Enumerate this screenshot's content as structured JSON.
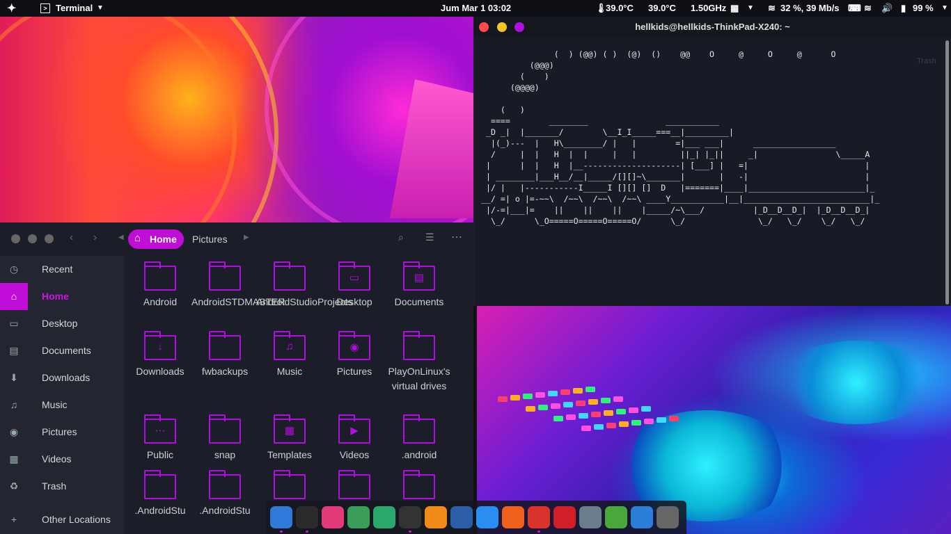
{
  "topbar": {
    "app_name": "Terminal",
    "clock": "Jum Mar 1  03:02",
    "temp1": "39.0°C",
    "temp2": "39.0°C",
    "cpu_freq": "1.50GHz",
    "net_speed": "32 %, 39 Mb/s",
    "battery": "99 %"
  },
  "terminal": {
    "title": "hellkids@hellkids-ThinkPad-X240: ~",
    "trash_label": "Trash",
    "ascii": "               (  ) (@@) ( )  (@)  ()    @@    O     @     O     @      O\n          (@@@)\n        (    )\n      (@@@@)\n\n    (   )\n  ====        ________                ___________\n _D _|  |_______/        \\__I_I_____===__|_________|\n  |(_)---  |   H\\________/ |   |        =|___ ___|      _________________\n  /     |  |   H  |  |     |   |         ||_| |_||     _|                \\_____A\n |      |  |   H  |__--------------------| [___] |   =|                        |\n | ________|___H__/__|_____/[][]~\\_______|       |   -|                        |\n |/ |   |-----------I_____I [][] []  D   |=======|____|________________________|_\n__/ =| o |=-~~\\  /~~\\  /~~\\  /~~\\ ____Y___________|__|__________________________|_\n |/-=|___|=    ||    ||    ||    |_____/~\\___/          |_D__D__D_|  |_D__D__D_|\n  \\_/      \\_O=====O=====O=====O/      \\_/               \\_/   \\_/    \\_/   \\_/"
  },
  "files": {
    "path": [
      {
        "label": "Home"
      },
      {
        "label": "Pictures"
      }
    ],
    "sidebar": [
      {
        "label": "Recent",
        "icon": "clock-icon",
        "glyph": "◷"
      },
      {
        "label": "Home",
        "icon": "home-icon",
        "glyph": "⌂"
      },
      {
        "label": "Desktop",
        "icon": "desktop-icon",
        "glyph": "▭"
      },
      {
        "label": "Documents",
        "icon": "documents-icon",
        "glyph": "▤"
      },
      {
        "label": "Downloads",
        "icon": "downloads-icon",
        "glyph": "⬇"
      },
      {
        "label": "Music",
        "icon": "music-icon",
        "glyph": "♫"
      },
      {
        "label": "Pictures",
        "icon": "camera-icon",
        "glyph": "◉"
      },
      {
        "label": "Videos",
        "icon": "film-icon",
        "glyph": "▦"
      },
      {
        "label": "Trash",
        "icon": "trash-icon",
        "glyph": "♻"
      },
      {
        "label": "Other Locations",
        "icon": "plus-icon",
        "glyph": "+"
      }
    ],
    "items": [
      {
        "name": "Android",
        "glyph": ""
      },
      {
        "name": "AndroidSTDMASTER",
        "glyph": ""
      },
      {
        "name": "AndroidStudioProjects",
        "glyph": ""
      },
      {
        "name": "Desktop",
        "glyph": "▭"
      },
      {
        "name": "Documents",
        "glyph": "▤"
      },
      {
        "name": "Downloads",
        "glyph": "↓"
      },
      {
        "name": "fwbackups",
        "glyph": ""
      },
      {
        "name": "Music",
        "glyph": "♫"
      },
      {
        "name": "Pictures",
        "glyph": "◉"
      },
      {
        "name": "PlayOnLinux's virtual drives",
        "glyph": ""
      },
      {
        "name": "Public",
        "glyph": "⋯"
      },
      {
        "name": "snap",
        "glyph": ""
      },
      {
        "name": "Templates",
        "glyph": "▦"
      },
      {
        "name": "Videos",
        "glyph": "▶"
      },
      {
        "name": ".android",
        "glyph": ""
      },
      {
        "name": ".AndroidStu",
        "glyph": ""
      },
      {
        "name": ".AndroidStu",
        "glyph": ""
      },
      {
        "name": "",
        "glyph": ""
      },
      {
        "name": "",
        "glyph": ""
      },
      {
        "name": "",
        "glyph": ""
      }
    ]
  },
  "dock": [
    {
      "name": "finder-icon",
      "c": "#2f7ad8"
    },
    {
      "name": "terminal-icon",
      "c": "#2a2a2a"
    },
    {
      "name": "itunes-icon",
      "c": "#e33a7a"
    },
    {
      "name": "android-studio-icon",
      "c": "#3b9c5a"
    },
    {
      "name": "atom-icon",
      "c": "#2aa76b"
    },
    {
      "name": "compass-icon",
      "c": "#333"
    },
    {
      "name": "vlc-icon",
      "c": "#f08a16"
    },
    {
      "name": "browser-icon",
      "c": "#2c5fa8"
    },
    {
      "name": "app-store-icon",
      "c": "#2a8df0"
    },
    {
      "name": "firefox-icon",
      "c": "#f0621c"
    },
    {
      "name": "chrome-icon",
      "c": "#d9342b"
    },
    {
      "name": "opera-icon",
      "c": "#d11f2a"
    },
    {
      "name": "screenshot-icon",
      "c": "#6a7d8c"
    },
    {
      "name": "downloader-icon",
      "c": "#4aa83a"
    },
    {
      "name": "files-icon",
      "c": "#2b7fd8"
    },
    {
      "name": "settings-icon",
      "c": "#666"
    }
  ]
}
